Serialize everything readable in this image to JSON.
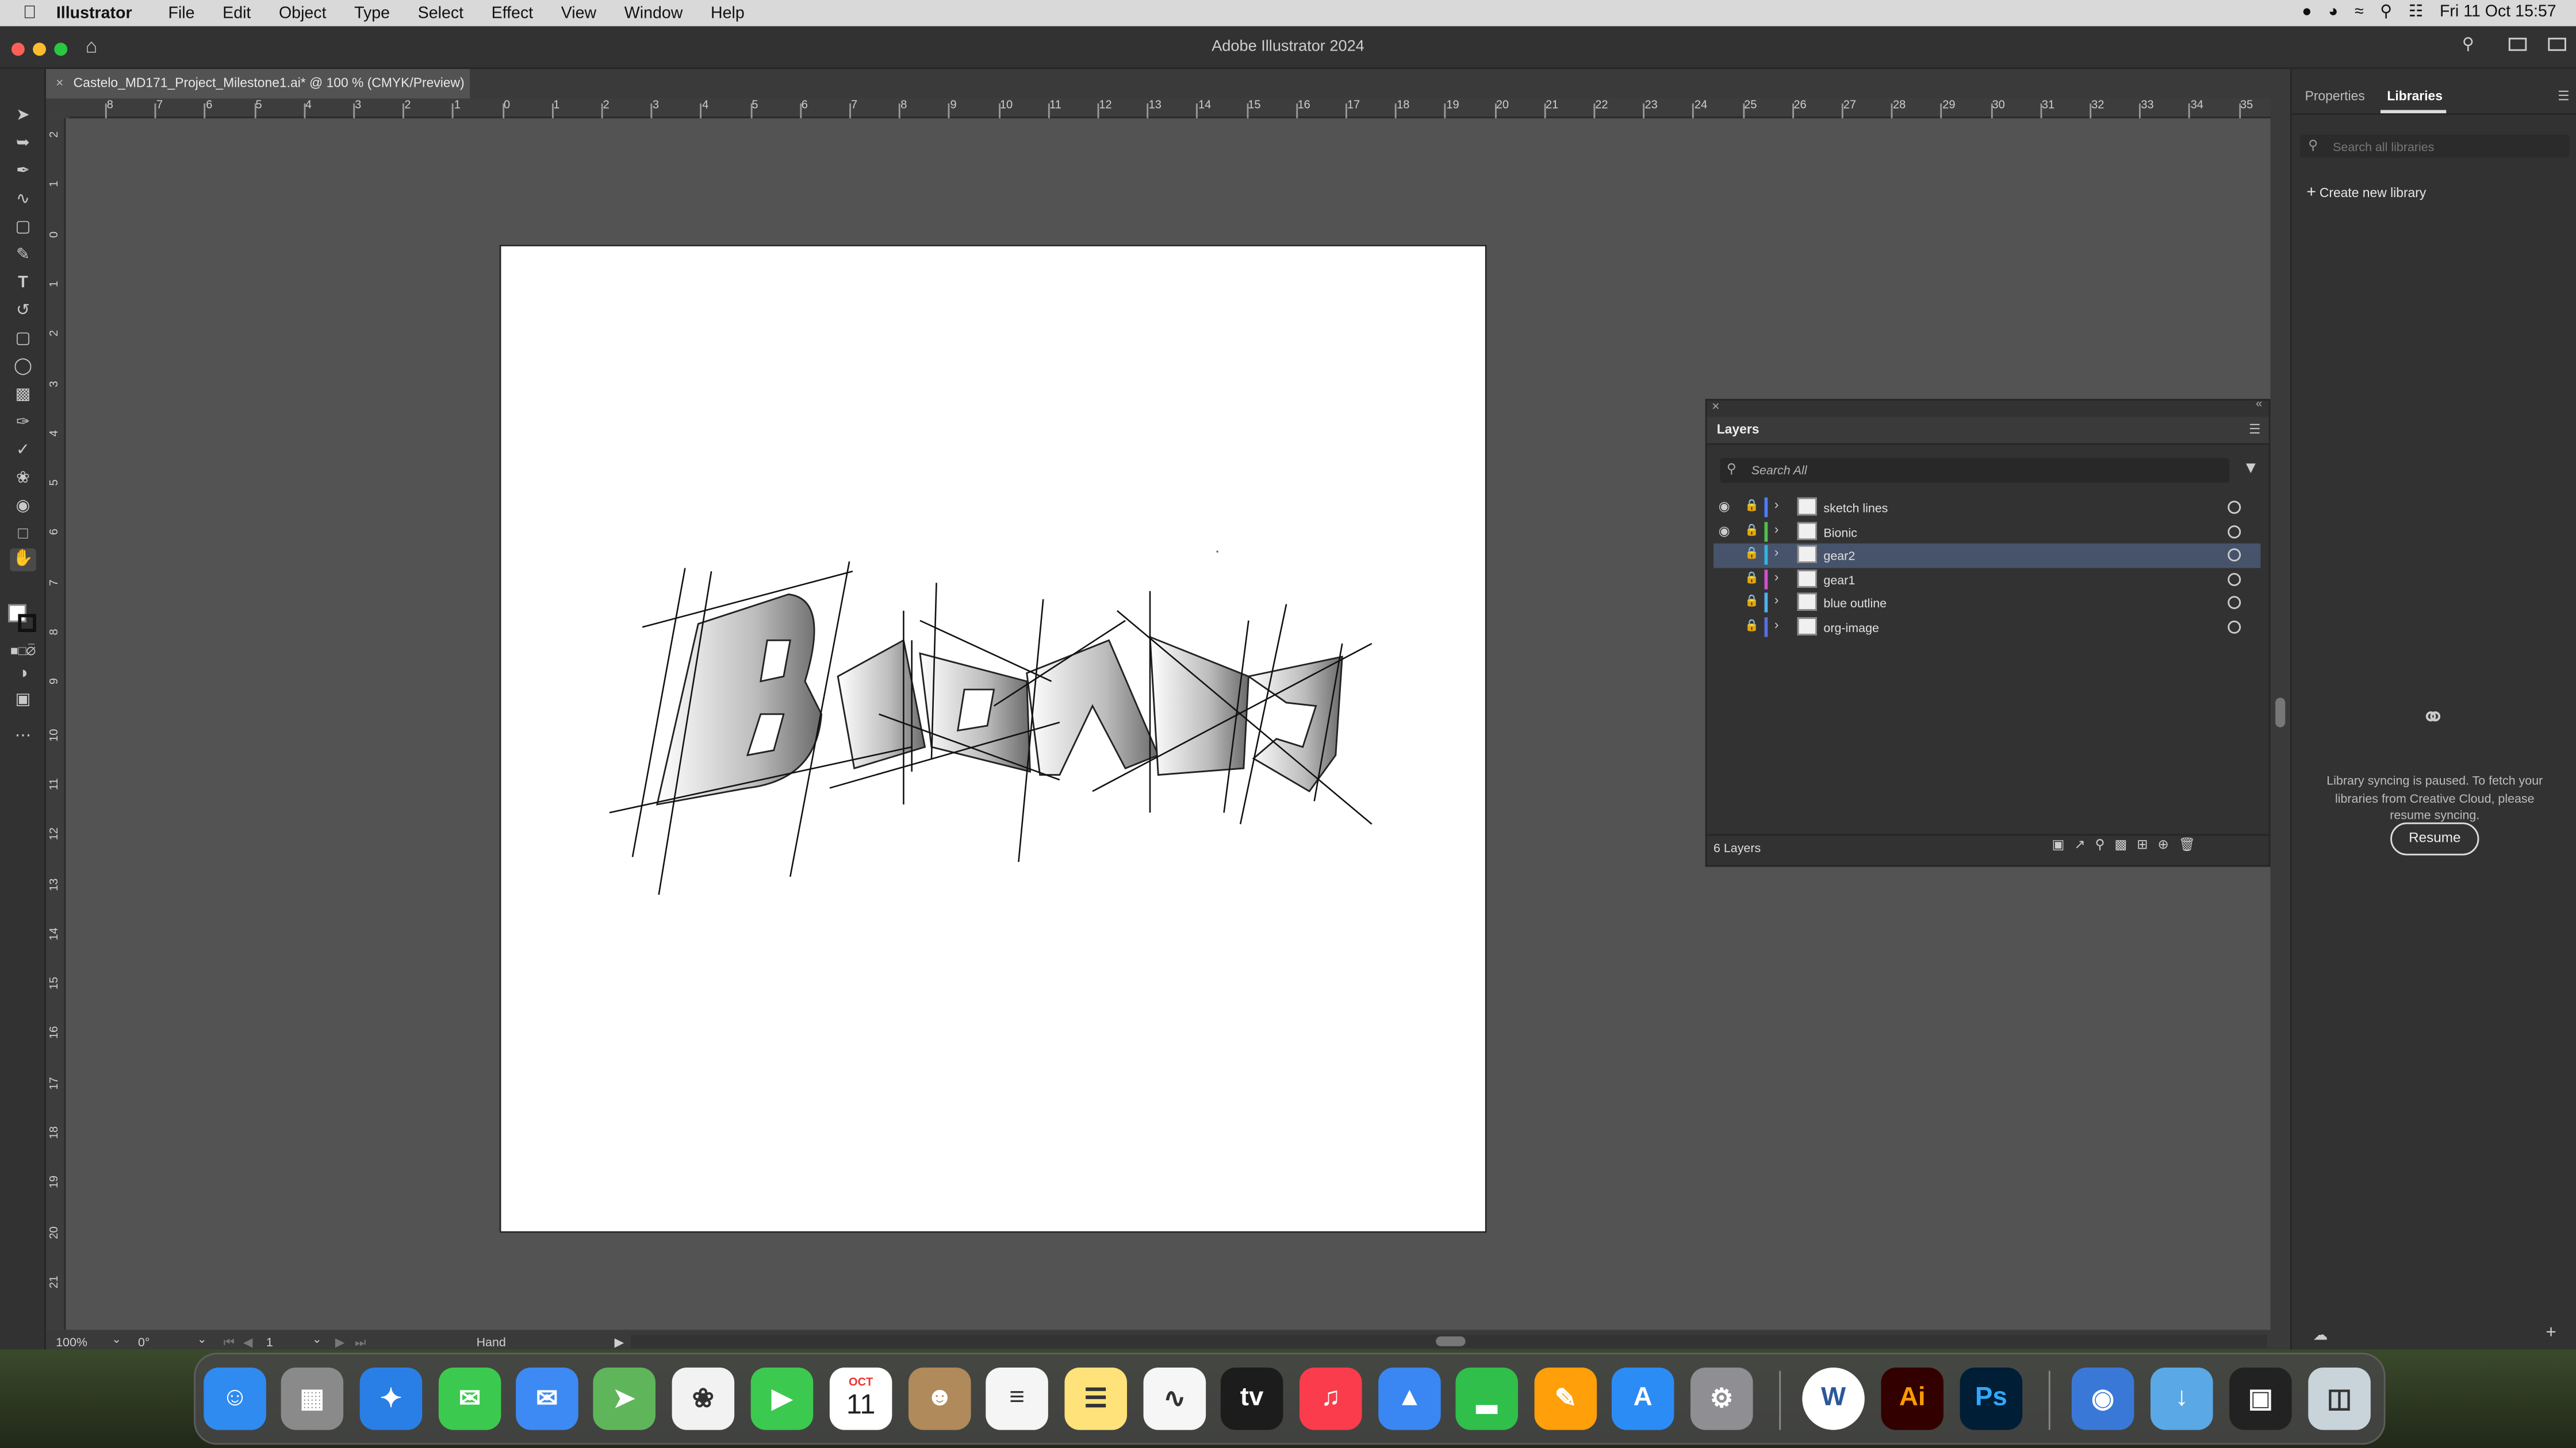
{
  "menubar": {
    "app_name": "Illustrator",
    "items": [
      "File",
      "Edit",
      "Object",
      "Type",
      "Select",
      "Effect",
      "View",
      "Window",
      "Help"
    ],
    "clock": "Fri 11 Oct  15:57"
  },
  "window": {
    "title": "Adobe Illustrator 2024"
  },
  "document_tab": {
    "label": "Castelo_MD171_Project_Milestone1.ai* @ 100 % (CMYK/Preview)"
  },
  "rulers": {
    "h_ticks": [
      "8",
      "7",
      "6",
      "5",
      "4",
      "3",
      "2",
      "1",
      "0",
      "1",
      "2",
      "3",
      "4",
      "5",
      "6",
      "7",
      "8",
      "9",
      "10",
      "11",
      "12",
      "13",
      "14",
      "15",
      "16",
      "17",
      "18",
      "19",
      "20",
      "21",
      "22",
      "23",
      "24",
      "25",
      "26",
      "27",
      "28",
      "29",
      "30",
      "31",
      "32",
      "33",
      "34",
      "35"
    ],
    "v_ticks": [
      "2",
      "1",
      "0",
      "1",
      "2",
      "3",
      "4",
      "5",
      "6",
      "7",
      "8",
      "9",
      "10",
      "11",
      "12",
      "13",
      "14",
      "15",
      "16",
      "17",
      "18",
      "19",
      "20",
      "21"
    ]
  },
  "status_bar": {
    "zoom": "100%",
    "rotation": "0°",
    "artboard": "1",
    "tool": "Hand"
  },
  "right_panel": {
    "tabs": [
      "Properties",
      "Libraries"
    ],
    "active_tab": "Libraries",
    "search_placeholder": "Search all libraries",
    "create_label": "Create new library",
    "sync_message": "Library syncing is paused. To fetch your libraries from Creative Cloud, please resume syncing.",
    "resume_label": "Resume"
  },
  "layers_panel": {
    "title": "Layers",
    "search_placeholder": "Search All",
    "layers": [
      {
        "name": "sketch lines",
        "visible": true,
        "color": "#4c7cff"
      },
      {
        "name": "Bionic",
        "visible": true,
        "color": "#4fc04a"
      },
      {
        "name": "gear2",
        "visible": false,
        "color": "#33b4e0",
        "selected": true
      },
      {
        "name": "gear1",
        "visible": false,
        "color": "#d24fd0"
      },
      {
        "name": "blue outline",
        "visible": false,
        "color": "#4fb0f0"
      },
      {
        "name": "org-image",
        "visible": false,
        "color": "#5a6fe0"
      }
    ],
    "count_label": "6 Layers"
  },
  "dock": {
    "apps": [
      "Finder",
      "Launchpad",
      "Safari",
      "Messages",
      "Mail",
      "Maps",
      "Photos",
      "FaceTime",
      "Calendar",
      "Contacts",
      "Reminders",
      "Notes",
      "Freeform",
      "TV",
      "Music",
      "Keynote",
      "Numbers",
      "Pages",
      "App Store",
      "System Settings",
      "Word",
      "Illustrator",
      "Photoshop",
      "Network",
      "Downloads",
      "Preview",
      "Trash"
    ],
    "calendar_month": "OCT",
    "calendar_day": "11"
  },
  "colors": {
    "accent": "#46536b",
    "app_bg": "#535353",
    "panel_bg": "#323232"
  }
}
